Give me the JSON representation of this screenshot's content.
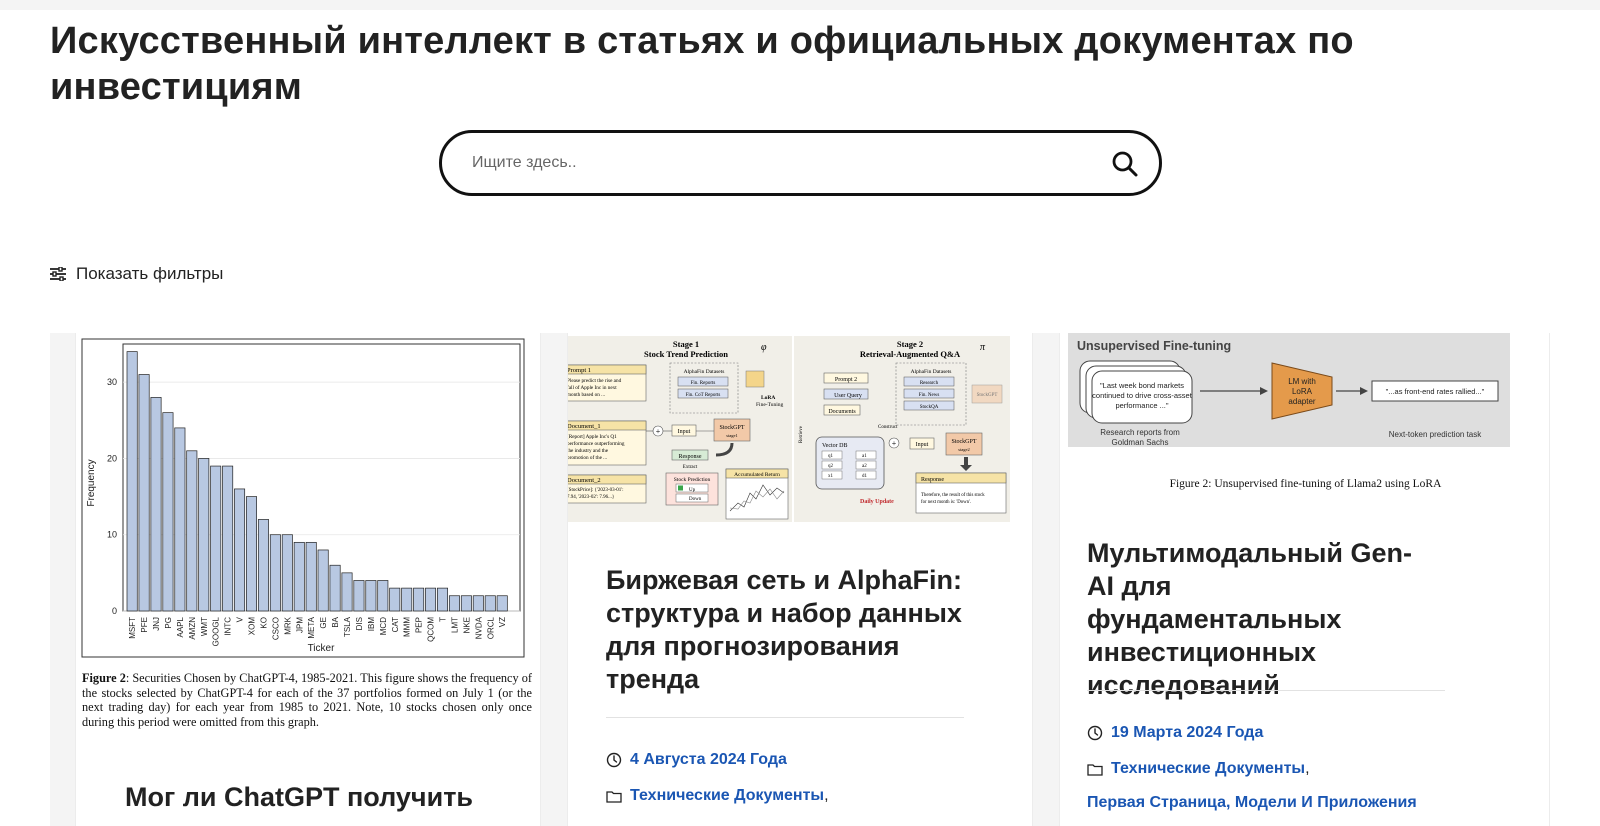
{
  "page": {
    "title": "Искусственный интеллект в статьях и официальных документах по инвестициям"
  },
  "search": {
    "placeholder": "Ищите здесь..",
    "icon": "search-icon"
  },
  "filters": {
    "label": "Показать фильтры",
    "icon": "sliders-icon"
  },
  "cards": [
    {
      "title": "Мог ли ChatGPT получить",
      "figure": {
        "caption_label": "Figure 2",
        "caption_text": ": Securities Chosen by ChatGPT-4, 1985-2021. This figure shows the frequency of the stocks selected by ChatGPT-4 for each of the 37 portfolios formed on July 1 (or the next trading day) for each year from 1985 to 2021. Note, 10 stocks chosen only once during this period were omitted from this graph."
      }
    },
    {
      "title": "Биржевая сеть и AlphaFin: структура и набор данных для прогнозирования тренда",
      "date": "4 Августа 2024 Года",
      "categories": "Технические Документы",
      "separator": ",",
      "figure": {
        "stage1_title": "Stage 1",
        "stage1_subtitle": "Stock Trend Prediction",
        "stage1_symbol": "φ",
        "stage2_title": "Stage 2",
        "stage2_subtitle": "Retrieval-Augmented Q&A",
        "stage2_symbol": "π",
        "prompt1": "Prompt 1",
        "prompt1_text": [
          "Please predict the rise and",
          "fall of Apple Inc in next",
          "month based on ..."
        ],
        "alphafin_datasets": "AlphaFin Datasets",
        "fin_reports": "Fin. Reports",
        "fin_cot_reports": "Fin. CoT Reports",
        "lora_tuning": [
          "LoRA",
          "Fine-Tuning"
        ],
        "document1": "Document_1",
        "document1_text": [
          "[Report] Apple Inc's Q1",
          "performance outperforming",
          "the industry and the",
          "promotion of the ..."
        ],
        "document2": "Document_2",
        "document2_text": [
          "[StockPrice]: {'2023-03-01':",
          "7.94, '2023-02': 7.96...}"
        ],
        "input": "Input",
        "stockgpt": "StockGPT",
        "stage1_label": "stage1",
        "stage2_label": "stage2",
        "response": "Response",
        "extract": "Extract",
        "stock_prediction": "Stock Prediction",
        "up": "Up",
        "down": "Down",
        "accumulated_return": "Accumulated Return",
        "prompt2": "Prompt 2",
        "user_query": "User Query",
        "documents": "Documents",
        "construct": "Construct",
        "vector_db": "Vector DB",
        "q_labels": [
          "q1",
          "q2",
          "x1"
        ],
        "a_labels": [
          "a1",
          "a2",
          "d1"
        ],
        "research": "Research",
        "fin_news": "Fin. News",
        "stockqa": "StockQA",
        "retrieve": "Retrieve",
        "daily_update": "Daily Update",
        "response2_text": [
          "Therefore, the result of this stock",
          "for next month is: 'Down'."
        ]
      }
    },
    {
      "title": "Мультимодальный Gen-AI для фундаментальных инвестиционных исследований",
      "date": "19 Марта 2024 Года",
      "categories": "Технические Документы",
      "separator": ",",
      "categories_more": "Первая Страница, Модели И Приложения",
      "figure": {
        "banner_title": "Unsupervised Fine-tuning",
        "quote_lines": [
          "\"Last week bond markets",
          "continued to drive cross-asset",
          "performance ...\""
        ],
        "lm_box": [
          "LM with",
          "LoRA",
          "adapter"
        ],
        "output": "\"...as front-end rates rallied...\"",
        "left_label": [
          "Research reports from",
          "Goldman Sachs"
        ],
        "right_label": "Next-token prediction task",
        "caption": "Figure 2: Unsupervised fine-tuning of Llama2 using LoRA"
      }
    }
  ],
  "chart_data": {
    "type": "bar",
    "xlabel": "Ticker",
    "ylabel": "Frequency",
    "ylim": [
      0,
      35
    ],
    "yticks": [
      0,
      10,
      20,
      30
    ],
    "grid": true,
    "categories": [
      "MSFT",
      "PFE",
      "JNJ",
      "PG",
      "AAPL",
      "AMZN",
      "WMT",
      "GOOGL",
      "INTC",
      "V",
      "XOM",
      "KO",
      "CSCO",
      "MRK",
      "JPM",
      "META",
      "GE",
      "BA",
      "TSLA",
      "DIS",
      "IBM",
      "MCD",
      "CAT",
      "MMM",
      "PEP",
      "QCOM",
      "T",
      "LMT",
      "NKE",
      "NVDA",
      "ORCL",
      "VZ"
    ],
    "values": [
      34,
      31,
      28,
      26,
      24,
      21,
      20,
      19,
      19,
      16,
      15,
      12,
      10,
      10,
      9,
      9,
      8,
      6,
      5,
      4,
      4,
      4,
      3,
      3,
      3,
      3,
      3,
      2,
      2,
      2,
      2,
      2
    ],
    "colors": {
      "bar": "#b8c8e2",
      "edge": "#222222"
    }
  }
}
